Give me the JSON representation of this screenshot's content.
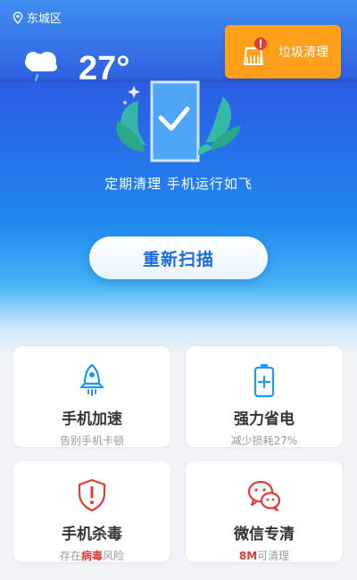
{
  "header": {
    "location": "东城区",
    "temperature": "27°",
    "weather_icon": "cloud-rain-icon",
    "junk_clean_label": "垃圾清理",
    "junk_clean_icon": "broom-alert-icon"
  },
  "hero": {
    "slogan": "定期清理  手机运行如飞",
    "rescan_label": "重新扫描"
  },
  "features": [
    {
      "title": "手机加速",
      "subtitle": "告别手机卡顿",
      "icon": "rocket-icon"
    },
    {
      "title": "强力省电",
      "subtitle": "减少损耗27%",
      "icon": "battery-icon"
    },
    {
      "title": "手机杀毒",
      "subtitle_prefix": "存在",
      "subtitle_highlight": "病毒",
      "subtitle_suffix": "风险",
      "icon": "shield-alert-icon"
    },
    {
      "title": "微信专清",
      "subtitle_highlight": "8M",
      "subtitle_suffix": "可清理",
      "icon": "wechat-icon"
    }
  ],
  "colors": {
    "accent_blue": "#1f6bd6",
    "orange": "#ff9f1a",
    "danger_red": "#e53935",
    "icon_blue": "#2196f3"
  }
}
